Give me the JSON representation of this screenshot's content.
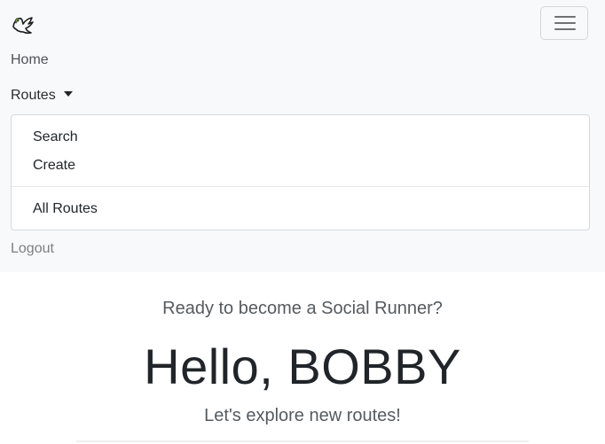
{
  "navbar": {
    "brand_icon": "dove-logo-icon",
    "toggler_icon": "hamburger-menu-icon",
    "links": {
      "home": "Home",
      "routes": "Routes",
      "logout": "Logout"
    },
    "routes_dropdown": {
      "items": [
        "Search",
        "Create"
      ],
      "footer_item": "All Routes"
    }
  },
  "hero": {
    "eyebrow": "Ready to become a Social Runner?",
    "greeting": "Hello, BOBBY",
    "subtitle": "Let's explore new routes!"
  },
  "colors": {
    "navbar_bg": "#f8f9fa",
    "page_bg": "#ffffff",
    "logo_accent": "#8ab83d"
  }
}
